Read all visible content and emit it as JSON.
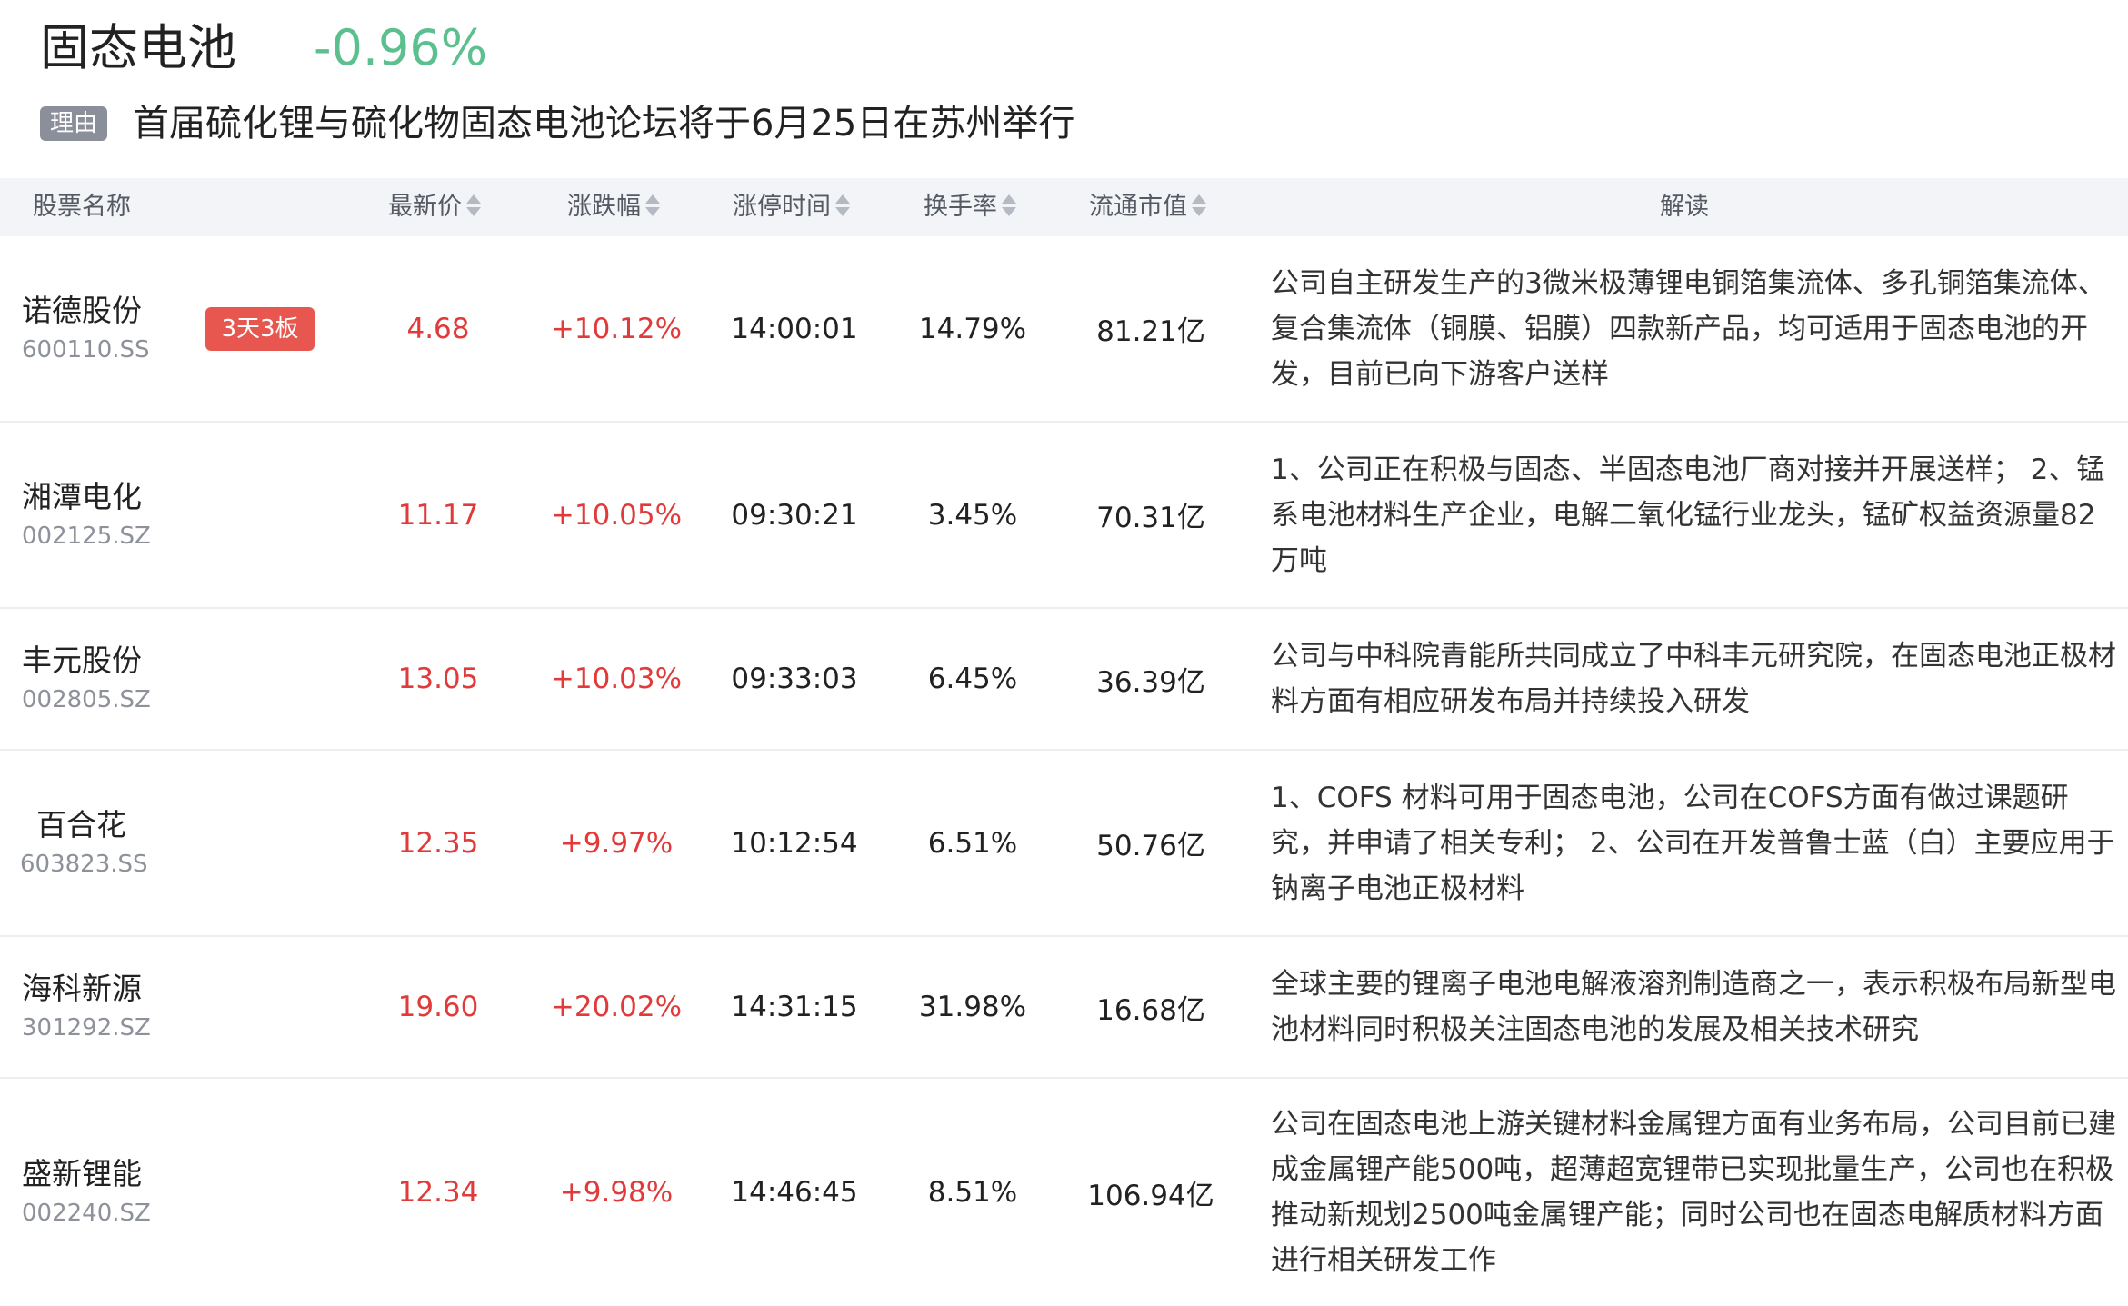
{
  "topic": {
    "title": "固态电池",
    "change": "-0.96%",
    "reason_label": "理由",
    "reason": "首届硫化锂与硫化物固态电池论坛将于6月25日在苏州举行"
  },
  "table": {
    "headers": {
      "name": "股票名称",
      "price": "最新价",
      "change": "涨跌幅",
      "limit_time": "涨停时间",
      "turnover": "换手率",
      "market_cap": "流通市值",
      "interpretation": "解读"
    },
    "rows": [
      {
        "name": "诺德股份",
        "code": "600110.SS",
        "badge": "3天3板",
        "price": "4.68",
        "change": "+10.12%",
        "limit_time": "14:00:01",
        "turnover": "14.79%",
        "market_cap": "81.21亿",
        "interpretation": "公司自主研发生产的3微米极薄锂电铜箔集流体、多孔铜箔集流体、复合集流体（铜膜、铝膜）四款新产品，均可适用于固态电池的开发，目前已向下游客户送样"
      },
      {
        "name": "湘潭电化",
        "code": "002125.SZ",
        "badge": "",
        "price": "11.17",
        "change": "+10.05%",
        "limit_time": "09:30:21",
        "turnover": "3.45%",
        "market_cap": "70.31亿",
        "interpretation": "1、公司正在积极与固态、半固态电池厂商对接并开展送样； 2、锰系电池材料生产企业，电解二氧化锰行业龙头，锰矿权益资源量82万吨"
      },
      {
        "name": "丰元股份",
        "code": "002805.SZ",
        "badge": "",
        "price": "13.05",
        "change": "+10.03%",
        "limit_time": "09:33:03",
        "turnover": "6.45%",
        "market_cap": "36.39亿",
        "interpretation": "公司与中科院青能所共同成立了中科丰元研究院，在固态电池正极材料方面有相应研发布局并持续投入研发"
      },
      {
        "name": "百合花",
        "code": "603823.SS",
        "badge": "",
        "price": "12.35",
        "change": "+9.97%",
        "limit_time": "10:12:54",
        "turnover": "6.51%",
        "market_cap": "50.76亿",
        "interpretation": "1、COFS 材料可用于固态电池，公司在COFS方面有做过课题研究，并申请了相关专利； 2、公司在开发普鲁士蓝（白）主要应用于钠离子电池正极材料"
      },
      {
        "name": "海科新源",
        "code": "301292.SZ",
        "badge": "",
        "price": "19.60",
        "change": "+20.02%",
        "limit_time": "14:31:15",
        "turnover": "31.98%",
        "market_cap": "16.68亿",
        "interpretation": "全球主要的锂离子电池电解液溶剂制造商之一，表示积极布局新型电池材料同时积极关注固态电池的发展及相关技术研究"
      },
      {
        "name": "盛新锂能",
        "code": "002240.SZ",
        "badge": "",
        "price": "12.34",
        "change": "+9.98%",
        "limit_time": "14:46:45",
        "turnover": "8.51%",
        "market_cap": "106.94亿",
        "interpretation": "公司在固态电池上游关键材料金属锂方面有业务布局，公司目前已建成金属锂产能500吨，超薄超宽锂带已实现批量生产，公司也在积极推动新规划2500吨金属锂产能；同时公司也在固态电解质材料方面进行相关研发工作"
      }
    ]
  }
}
